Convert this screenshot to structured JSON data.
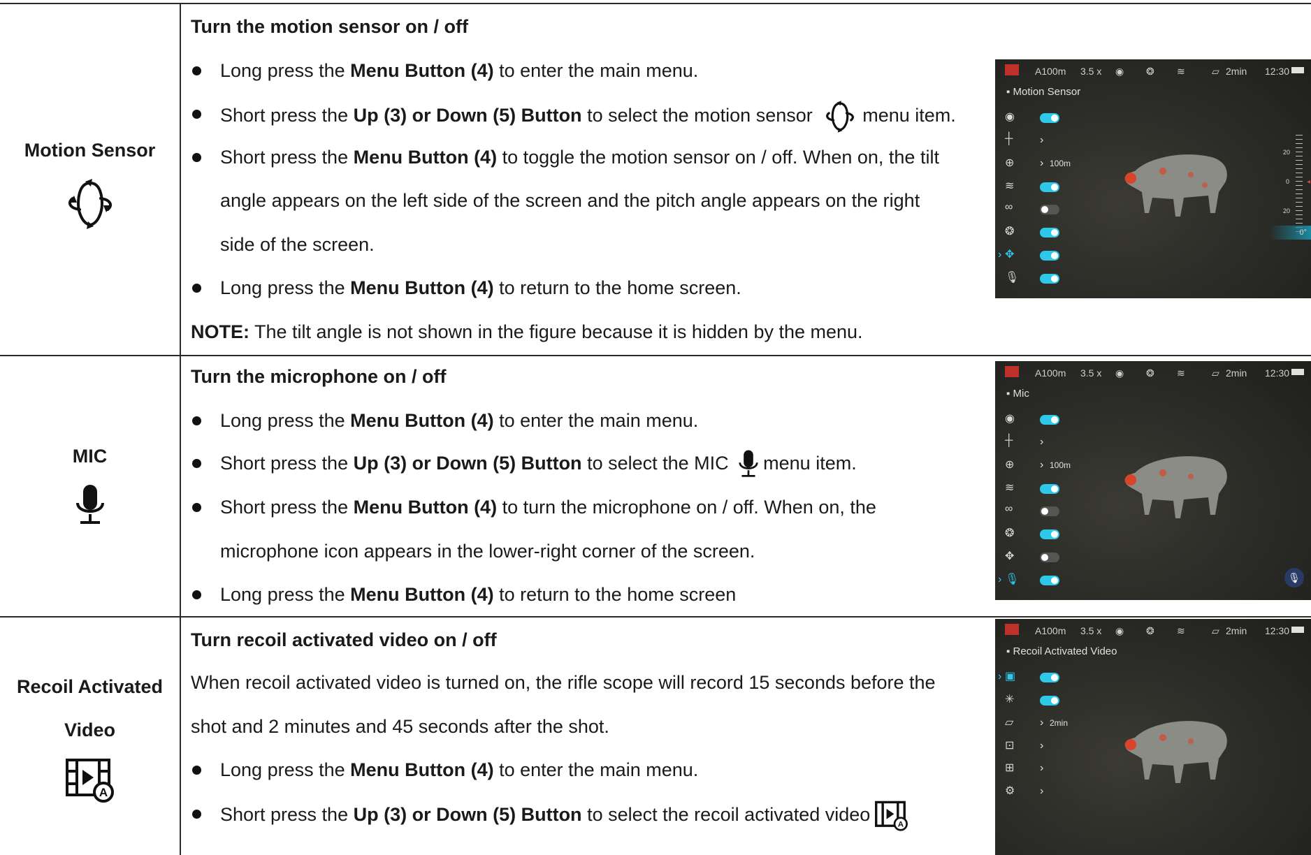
{
  "rows": [
    {
      "header": {
        "title_lines": [
          "Motion Sensor"
        ],
        "icon": "motion-sensor-icon"
      },
      "heading": "Turn the motion sensor on / off",
      "lines": [
        {
          "type": "bullet",
          "parts": [
            "Long press the ",
            "Menu Button (4)",
            " to enter the main menu."
          ]
        },
        {
          "type": "bullet",
          "parts": [
            "Short press the ",
            "Up (3) or Down (5) Button",
            " to select the motion sensor ",
            "menu item."
          ],
          "icon": "motion-sensor-icon"
        },
        {
          "type": "bullet",
          "parts": [
            "Short press the ",
            "Menu Button (4)",
            " to toggle the motion sensor on / off. When on, the tilt"
          ]
        },
        {
          "type": "cont",
          "text": "angle appears on the left side of the screen and the pitch angle appears on the right"
        },
        {
          "type": "cont",
          "text": "side of the screen."
        },
        {
          "type": "bullet",
          "parts": [
            "Long press the ",
            "Menu Button (4)",
            " to return to the home screen."
          ]
        },
        {
          "type": "note",
          "label": "NOTE:",
          "text": " The tilt angle is not shown in the figure because it is hidden by the menu."
        }
      ],
      "screen": {
        "status": {
          "range": "A100m",
          "zoom": "3.5 x",
          "timer": "2min",
          "time": "12:30"
        },
        "menu_title": "▪ Motion Sensor",
        "items": [
          {
            "icon": "eye-icon",
            "kind": "toggle",
            "state": "on"
          },
          {
            "icon": "crosshair-icon",
            "kind": "arrow"
          },
          {
            "icon": "rangefinder-icon",
            "kind": "arrow",
            "value": "100m"
          },
          {
            "icon": "wifi-icon",
            "kind": "toggle",
            "state": "on"
          },
          {
            "icon": "link-icon",
            "kind": "toggle",
            "state": "off"
          },
          {
            "icon": "aperture-icon",
            "kind": "toggle",
            "state": "on"
          },
          {
            "icon": "motion-sensor-icon",
            "kind": "toggle",
            "state": "on",
            "selected": true
          },
          {
            "icon": "mic-icon",
            "kind": "toggle",
            "state": "on"
          }
        ],
        "pitch_scale": {
          "top": "20",
          "mid": "0",
          "bottom": "20",
          "reading": "0°"
        }
      }
    },
    {
      "header": {
        "title_lines": [
          "MIC"
        ],
        "icon": "mic-icon"
      },
      "heading": "Turn the microphone on / off",
      "lines": [
        {
          "type": "bullet",
          "parts": [
            "Long press the ",
            "Menu Button (4)",
            " to enter the main menu."
          ]
        },
        {
          "type": "bullet",
          "parts": [
            "Short press the ",
            "Up (3) or Down (5) Button",
            " to select the MIC ",
            "menu item."
          ],
          "icon": "mic-icon"
        },
        {
          "type": "bullet",
          "parts": [
            "Short press the ",
            "Menu Button (4)",
            " to turn the microphone on / off. When on, the"
          ]
        },
        {
          "type": "cont",
          "text": "microphone icon appears in the lower-right corner of the screen."
        },
        {
          "type": "bullet",
          "parts": [
            "Long press the ",
            "Menu Button (4)",
            " to return to the home screen"
          ]
        }
      ],
      "screen": {
        "status": {
          "range": "A100m",
          "zoom": "3.5 x",
          "timer": "2min",
          "time": "12:30"
        },
        "menu_title": "▪ Mic",
        "items": [
          {
            "icon": "eye-icon",
            "kind": "toggle",
            "state": "on"
          },
          {
            "icon": "crosshair-icon",
            "kind": "arrow"
          },
          {
            "icon": "rangefinder-icon",
            "kind": "arrow",
            "value": "100m"
          },
          {
            "icon": "wifi-icon",
            "kind": "toggle",
            "state": "on"
          },
          {
            "icon": "link-icon",
            "kind": "toggle",
            "state": "off"
          },
          {
            "icon": "aperture-icon",
            "kind": "toggle",
            "state": "on"
          },
          {
            "icon": "motion-sensor-icon",
            "kind": "toggle",
            "state": "off"
          },
          {
            "icon": "mic-icon",
            "kind": "toggle",
            "state": "on",
            "selected": true
          }
        ]
      }
    },
    {
      "header": {
        "title_lines": [
          "Recoil Activated",
          "Video"
        ],
        "icon": "recoil-video-icon"
      },
      "heading": "Turn recoil activated video on / off",
      "lines": [
        {
          "type": "plain",
          "text": "When recoil activated video is turned on, the rifle scope will record 15 seconds before the"
        },
        {
          "type": "plain",
          "text": "shot and 2 minutes and 45 seconds after the shot."
        },
        {
          "type": "bullet",
          "parts": [
            "Long press the ",
            "Menu Button (4)",
            " to enter the main menu."
          ]
        },
        {
          "type": "bullet",
          "parts": [
            "Short press the ",
            "Up (3) or Down (5) Button",
            " to select the recoil activated video",
            ""
          ],
          "icon": "recoil-video-icon"
        }
      ],
      "screen": {
        "status": {
          "range": "A100m",
          "zoom": "3.5 x",
          "timer": "2min",
          "time": "12:30"
        },
        "menu_title": "▪ Recoil Activated Video",
        "items": [
          {
            "icon": "recoil-video-icon",
            "kind": "toggle",
            "state": "on",
            "selected": true
          },
          {
            "icon": "sparkle-icon",
            "kind": "toggle",
            "state": "on"
          },
          {
            "icon": "screen-off-icon",
            "kind": "arrow",
            "value": "2min"
          },
          {
            "icon": "pip-icon",
            "kind": "arrow"
          },
          {
            "icon": "grid-icon",
            "kind": "arrow"
          },
          {
            "icon": "settings-icon",
            "kind": "arrow"
          }
        ]
      }
    }
  ]
}
